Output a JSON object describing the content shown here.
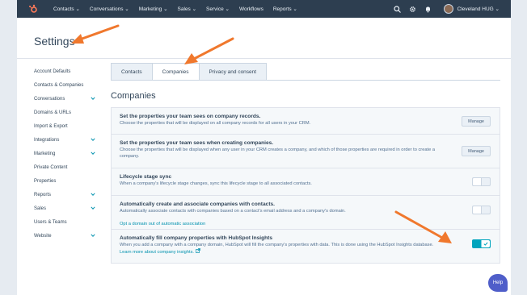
{
  "nav": {
    "items": [
      "Contacts ⌄",
      "Conversations ⌄",
      "Marketing ⌄",
      "Sales ⌄",
      "Service ⌄",
      "Workflows",
      "Reports ⌄"
    ],
    "user_name": "Cleveland HUG ⌄"
  },
  "page": {
    "title": "Settings"
  },
  "sidebar": {
    "items": [
      {
        "label": "Account Defaults"
      },
      {
        "label": "Contacts & Companies"
      },
      {
        "label": "Conversations"
      },
      {
        "label": "Domains & URLs"
      },
      {
        "label": "Import & Export"
      },
      {
        "label": "Integrations"
      },
      {
        "label": "Marketing"
      },
      {
        "label": "Private Content"
      },
      {
        "label": "Properties"
      },
      {
        "label": "Reports"
      },
      {
        "label": "Sales"
      },
      {
        "label": "Users & Teams"
      },
      {
        "label": "Website"
      }
    ]
  },
  "tabs": [
    {
      "label": "Contacts",
      "active": false
    },
    {
      "label": "Companies",
      "active": true
    },
    {
      "label": "Privacy and consent",
      "active": false
    }
  ],
  "section": {
    "title": "Companies"
  },
  "settings": [
    {
      "title": "Set the properties your team sees on company records.",
      "desc": "Choose the properties that will be displayed on all company records for all users in your CRM.",
      "button": "Manage"
    },
    {
      "title": "Set the properties your team sees when creating companies.",
      "desc": "Choose the properties that will be displayed when any user in your CRM creates a company, and which of those properties are required in order to create a company.",
      "button": "Manage"
    },
    {
      "title": "Lifecycle stage sync",
      "desc": "When a company's lifecycle stage changes, sync this lifecycle stage to all associated contacts.",
      "toggle_on": false
    },
    {
      "title": "Automatically create and associate companies with contacts.",
      "desc": "Automatically associate contacts with companies based on a contact's email address and a company's domain.",
      "link": "Opt a domain out of automatic association",
      "toggle_on": false
    },
    {
      "title": "Automatically fill company properties with HubSpot Insights",
      "desc": "When you add a company with a company domain, HubSpot will fill the company's properties with data. This is done using the HubSpot Insights database.",
      "link": "Learn more about company insights.",
      "toggle_on": true
    }
  ],
  "help": {
    "label": "Help"
  },
  "colors": {
    "nav_bg": "#2d3e50",
    "accent": "#00a4bd",
    "annotation_arrow": "#f0782d",
    "help": "#4f5ec9"
  }
}
